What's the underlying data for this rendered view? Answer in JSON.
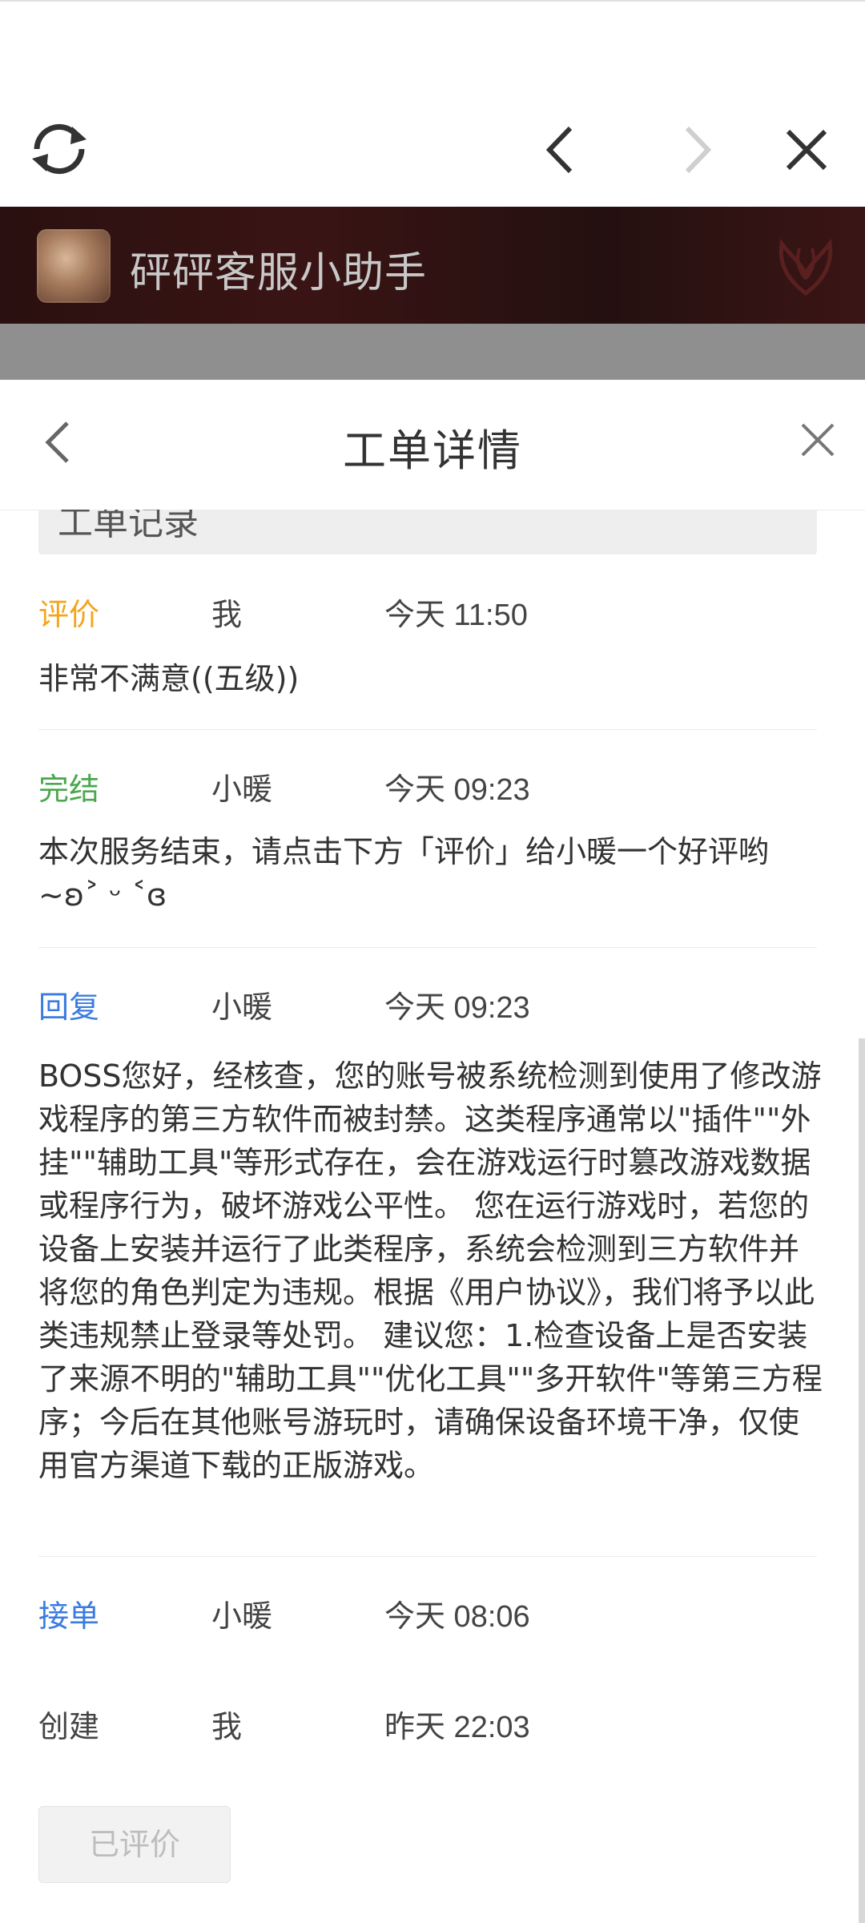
{
  "browser": {
    "icons": [
      "refresh-icon",
      "back-icon",
      "forward-icon",
      "close-icon"
    ]
  },
  "banner": {
    "title": "砰砰客服小助手"
  },
  "sheet": {
    "title": "工单详情",
    "section_title": "工单记录"
  },
  "records": [
    {
      "type": "评价",
      "who": "我",
      "time": "今天 11:50",
      "message": "非常不满意((五级))",
      "color": "#f5a51c"
    },
    {
      "type": "完结",
      "who": "小暖",
      "time": "今天 09:23",
      "message": "本次服务结束，请点击下方「评价」给小暖一个好评哟~ʚ˃ ᵕ ˂ɞ",
      "color": "#4aa84d"
    },
    {
      "type": "回复",
      "who": "小暖",
      "time": "今天 09:23",
      "message": "BOSS您好，经核查，您的账号被系统检测到使用了修改游戏程序的第三方软件而被封禁。这类程序通常以\"插件\"\"外挂\"\"辅助工具\"等形式存在，会在游戏运行时篡改游戏数据或程序行为，破坏游戏公平性。 您在运行游戏时，若您的设备上安装并运行了此类程序，系统会检测到三方软件并将您的角色判定为违规。根据《用户协议》，我们将予以此类违规禁止登录等处罚。 建议您：1.检查设备上是否安装了来源不明的\"辅助工具\"\"优化工具\"\"多开软件\"等第三方程序；今后在其他账号游玩时，请确保设备环境干净，仅使用官方渠道下载的正版游戏。",
      "color": "#3a7be0"
    },
    {
      "type": "接单",
      "who": "小暖",
      "time": "今天 08:06",
      "message": "",
      "color": "#3a7be0"
    },
    {
      "type": "创建",
      "who": "我",
      "time": "昨天 22:03",
      "message": "",
      "color": "#444444"
    }
  ],
  "rated_button": "已评价"
}
